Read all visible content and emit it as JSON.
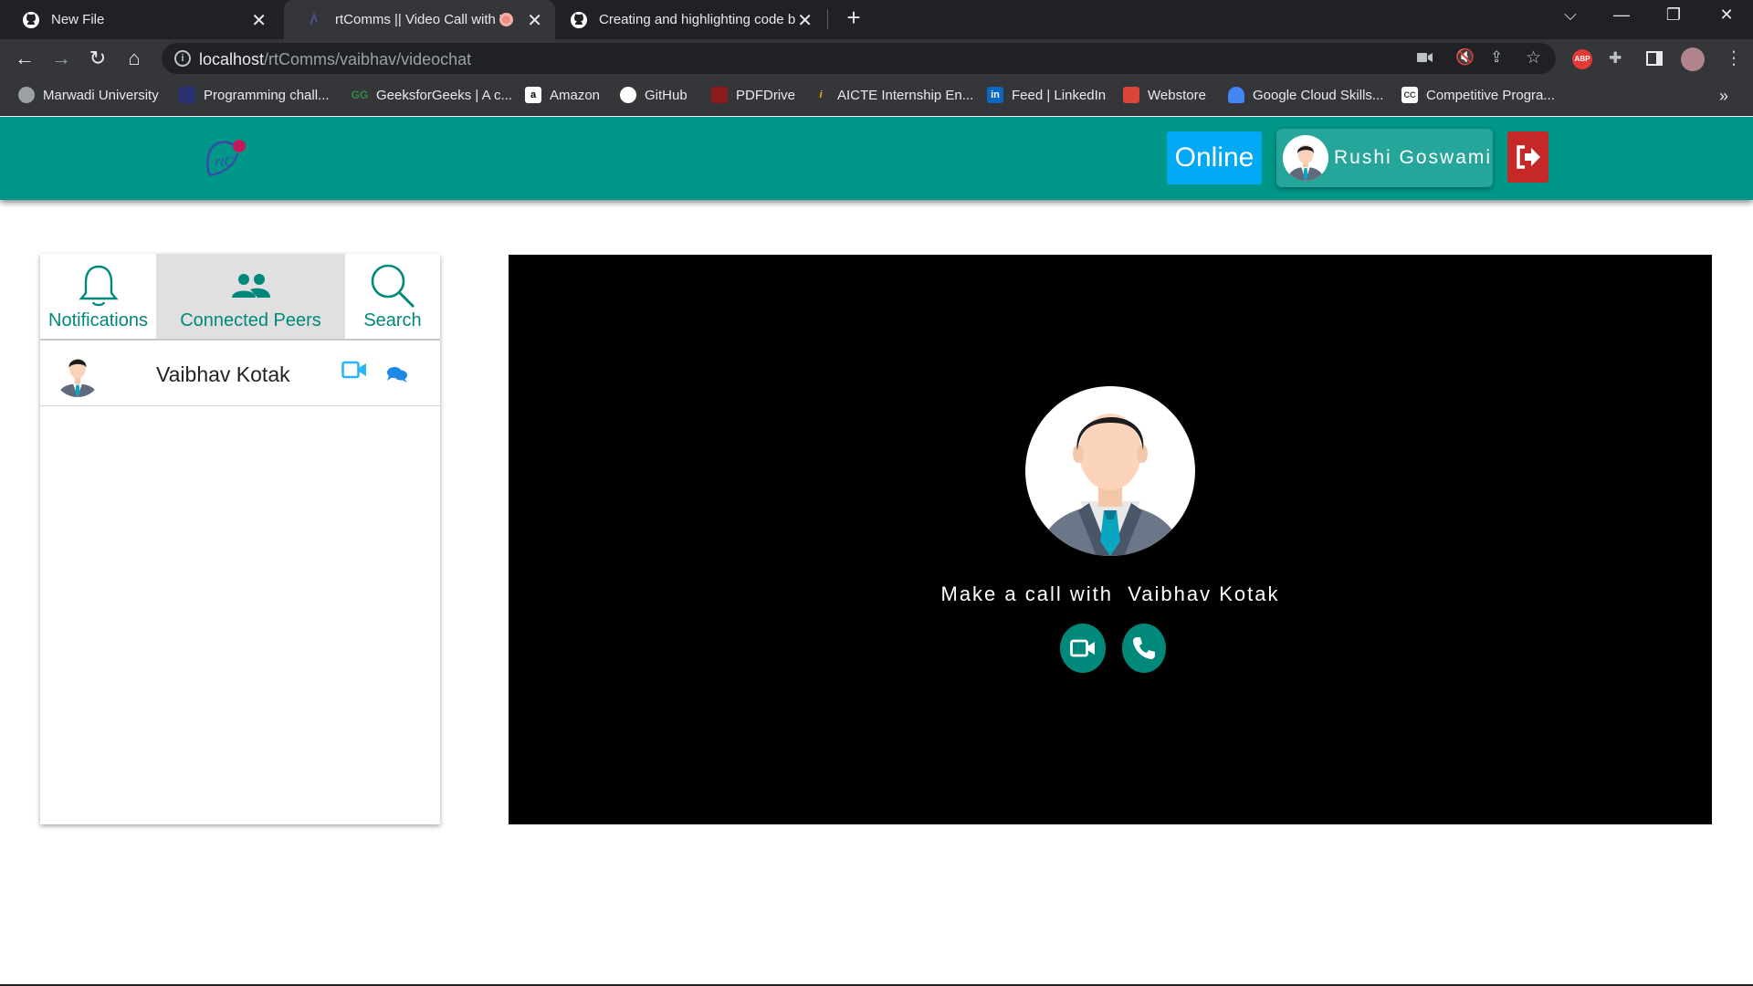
{
  "browser": {
    "tabs": [
      {
        "title": "New File"
      },
      {
        "title": "rtComms || Video Call with V"
      },
      {
        "title": "Creating and highlighting code b"
      }
    ],
    "url_host": "localhost",
    "url_path": "/rtComms/vaibhav/videochat",
    "extension_label": "ABP",
    "bookmarks": [
      "Marwadi University",
      "Programming chall...",
      "GeeksforGeeks | A c...",
      "Amazon",
      "GitHub",
      "PDFDrive",
      "AICTE Internship En...",
      "Feed | LinkedIn",
      "Webstore",
      "Google Cloud Skills...",
      "Competitive Progra..."
    ],
    "bookmark_icon_letters": {
      "amazon": "a",
      "linkedin": "in",
      "competitive": "CC",
      "aicte": "i"
    }
  },
  "app": {
    "logo_text": "rtC",
    "status": "Online",
    "user_name": "Rushi Goswami",
    "colors": {
      "header": "#009688",
      "status": "#03a9f4",
      "logout": "#c62828",
      "accent": "#00897b",
      "video_icon": "#29b6f6"
    }
  },
  "sidebar": {
    "tabs": [
      {
        "label": "Notifications",
        "icon": "bell-icon",
        "selected": false
      },
      {
        "label": "Connected Peers",
        "icon": "people-icon",
        "selected": true
      },
      {
        "label": "Search",
        "icon": "search-icon",
        "selected": false
      }
    ],
    "peers": [
      {
        "name": "Vaibhav Kotak"
      }
    ]
  },
  "call": {
    "prompt": "Make a call with",
    "peer_name": "Vaibhav Kotak"
  }
}
